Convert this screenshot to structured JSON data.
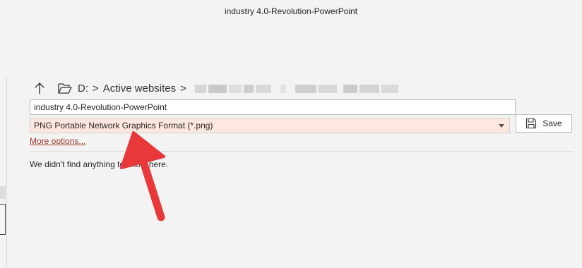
{
  "window": {
    "title": "industry 4.0-Revolution-PowerPoint"
  },
  "nav": {
    "up_icon": "arrow-up-icon",
    "folder_icon": "folder-open-icon",
    "breadcrumb": {
      "drive": "D:",
      "folder": "Active websites",
      "separator": ">"
    }
  },
  "form": {
    "filename_value": "industry 4.0-Revolution-PowerPoint",
    "filetype_value": "PNG Portable Network Graphics Format (*.png)",
    "save_label": "Save",
    "more_options_label": "More options..."
  },
  "results": {
    "empty_message": "We didn't find anything to show here."
  },
  "colors": {
    "filetype_highlight": "#fde7df",
    "link": "#a0392a",
    "annotation_arrow": "#e8383a"
  }
}
